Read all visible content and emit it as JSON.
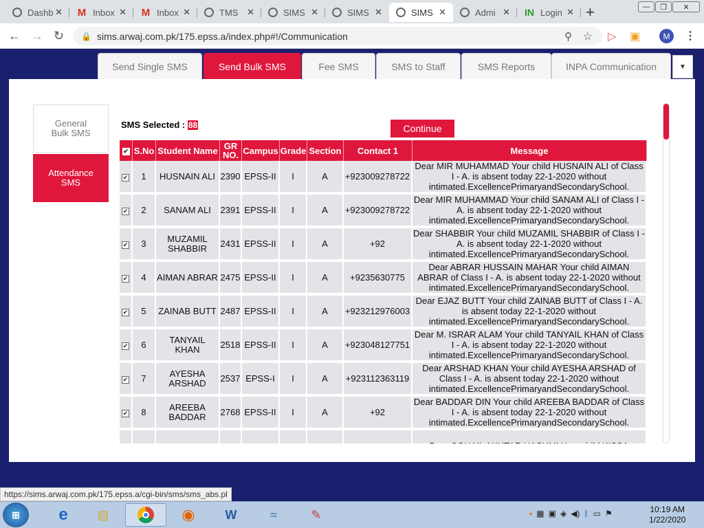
{
  "browser": {
    "tabs": [
      {
        "title": "Dashb",
        "icon": "globe-icon"
      },
      {
        "title": "Inbox",
        "icon": "gmail-icon"
      },
      {
        "title": "Inbox",
        "icon": "gmail-icon"
      },
      {
        "title": "TMS",
        "icon": "globe-icon"
      },
      {
        "title": "SIMS",
        "icon": "globe-icon"
      },
      {
        "title": "SIMS",
        "icon": "globe-icon"
      },
      {
        "title": "SIMS",
        "icon": "globe-icon"
      },
      {
        "title": "Admi",
        "icon": "globe-icon"
      },
      {
        "title": "Login",
        "icon": "inpa-icon"
      }
    ],
    "url": "sims.arwaj.com.pk/175.epss.a/index.php#!/Communication",
    "profile_initial": "M",
    "status_url": "https://sims.arwaj.com.pk/175.epss.a/cgi-bin/sms/sms_abs.pl"
  },
  "app_tabs": [
    {
      "label": "Send Single SMS",
      "active": false
    },
    {
      "label": "Send Bulk SMS",
      "active": true
    },
    {
      "label": "Fee SMS",
      "active": false
    },
    {
      "label": "SMS to Staff",
      "active": false
    },
    {
      "label": "SMS Reports",
      "active": false
    },
    {
      "label": "INPA Communication",
      "active": false
    }
  ],
  "side_nav": [
    {
      "label": "General Bulk SMS",
      "active": false
    },
    {
      "label": "Attendance SMS",
      "active": true
    }
  ],
  "sms_selected": {
    "label": "SMS Selected :",
    "count": "88"
  },
  "continue_label": "Continue",
  "table": {
    "headers": [
      "S.No",
      "Student Name",
      "GR NO.",
      "Campus",
      "Grade",
      "Section",
      "Contact 1",
      "Message"
    ],
    "rows": [
      {
        "sno": "1",
        "name": "HUSNAIN ALI",
        "gr": "2390",
        "campus": "EPSS-II",
        "grade": "I",
        "section": "A",
        "contact": "+923009278722",
        "message": "Dear MIR MUHAMMAD Your child HUSNAIN ALI of Class I - A. is absent today 22-1-2020 without intimated.ExcellencePrimaryandSecondarySchool."
      },
      {
        "sno": "2",
        "name": "SANAM ALI",
        "gr": "2391",
        "campus": "EPSS-II",
        "grade": "I",
        "section": "A",
        "contact": "+923009278722",
        "message": "Dear MIR MUHAMMAD Your child SANAM ALI of Class I - A. is absent today 22-1-2020 without intimated.ExcellencePrimaryandSecondarySchool."
      },
      {
        "sno": "3",
        "name": "MUZAMIL SHABBIR",
        "gr": "2431",
        "campus": "EPSS-II",
        "grade": "I",
        "section": "A",
        "contact": "+92",
        "message": "Dear SHABBIR Your child MUZAMIL SHABBIR of Class I - A. is absent today 22-1-2020 without intimated.ExcellencePrimaryandSecondarySchool."
      },
      {
        "sno": "4",
        "name": "AIMAN ABRAR",
        "gr": "2475",
        "campus": "EPSS-II",
        "grade": "I",
        "section": "A",
        "contact": "+9235630775",
        "message": "Dear ABRAR HUSSAIN MAHAR Your child AIMAN ABRAR of Class I - A. is absent today 22-1-2020 without intimated.ExcellencePrimaryandSecondarySchool."
      },
      {
        "sno": "5",
        "name": "ZAINAB BUTT",
        "gr": "2487",
        "campus": "EPSS-II",
        "grade": "I",
        "section": "A",
        "contact": "+923212976003",
        "message": "Dear EJAZ BUTT Your child ZAINAB BUTT of Class I - A. is absent today 22-1-2020 without intimated.ExcellencePrimaryandSecondarySchool."
      },
      {
        "sno": "6",
        "name": "TANYAIL KHAN",
        "gr": "2518",
        "campus": "EPSS-II",
        "grade": "I",
        "section": "A",
        "contact": "+923048127751",
        "message": "Dear M. ISRAR ALAM Your child TANYAIL KHAN of Class I - A. is absent today 22-1-2020 without intimated.ExcellencePrimaryandSecondarySchool."
      },
      {
        "sno": "7",
        "name": "AYESHA ARSHAD",
        "gr": "2537",
        "campus": "EPSS-I",
        "grade": "I",
        "section": "A",
        "contact": "+923112363119",
        "message": "Dear ARSHAD KHAN Your child AYESHA ARSHAD of Class I - A. is absent today 22-1-2020 without intimated.ExcellencePrimaryandSecondarySchool."
      },
      {
        "sno": "8",
        "name": "AREEBA BADDAR",
        "gr": "2768",
        "campus": "EPSS-II",
        "grade": "I",
        "section": "A",
        "contact": "+92",
        "message": "Dear BADDAR DIN Your child AREEBA BADDAR of Class I - A. is absent today 22-1-2020 without intimated.ExcellencePrimaryandSecondarySchool."
      },
      {
        "sno": "",
        "name": "",
        "gr": "",
        "campus": "",
        "grade": "",
        "section": "",
        "contact": "",
        "message": "Dear SOHAIL AKHTAR HASHMI Your child KISSA"
      }
    ]
  },
  "taskbar": {
    "time": "10:19 AM",
    "date": "1/22/2020"
  },
  "colors": {
    "accent": "#e0173c",
    "page_bg": "#1a1f6e"
  }
}
